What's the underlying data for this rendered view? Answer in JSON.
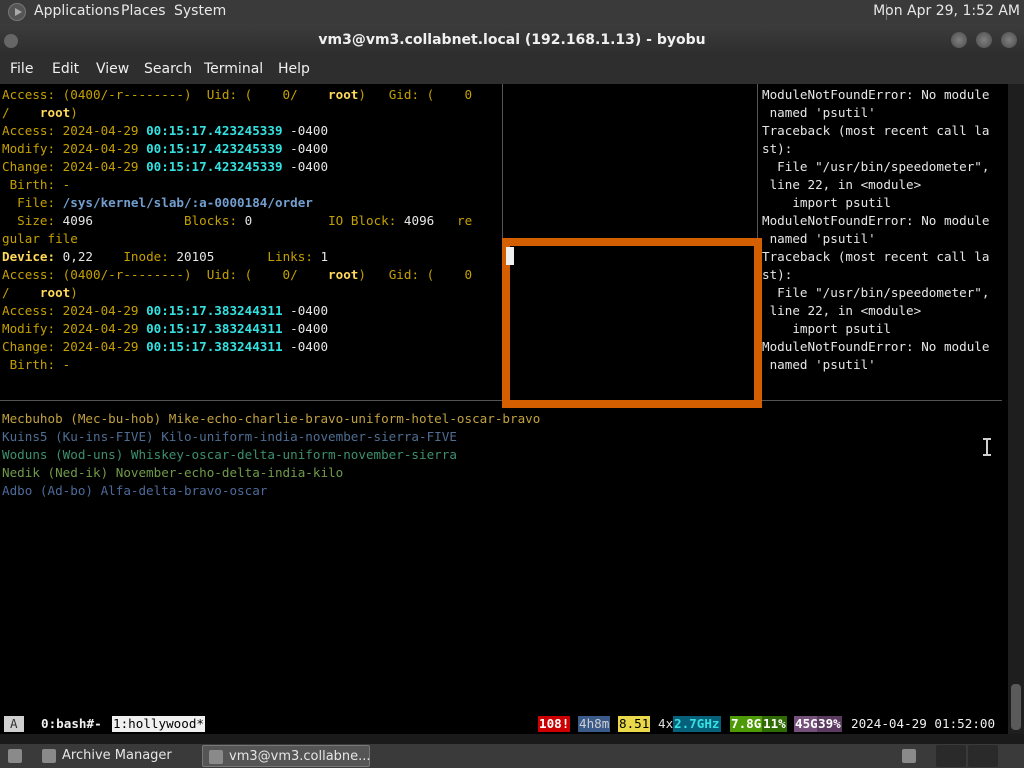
{
  "top_panel": {
    "menus": [
      "Applications",
      "Places",
      "System"
    ],
    "clock": "Mon Apr 29,  1:52 AM"
  },
  "window": {
    "title": "vm3@vm3.collabnet.local (192.168.1.13) - byobu",
    "menu": [
      "File",
      "Edit",
      "View",
      "Search",
      "Terminal",
      "Help"
    ]
  },
  "left_pane": {
    "lines": [
      [
        {
          "t": "Access: (0400/-r--------)  Uid: (    0/    ",
          "c": "c-y"
        },
        {
          "t": "root",
          "c": "c-ry"
        },
        {
          "t": ")   Gid: (    0",
          "c": "c-y"
        }
      ],
      [
        {
          "t": "/    ",
          "c": "c-y"
        },
        {
          "t": "root",
          "c": "c-ry"
        },
        {
          "t": ")",
          "c": "c-y"
        }
      ],
      [
        {
          "t": "Access: 2024-04-29 ",
          "c": "c-y"
        },
        {
          "t": "00:15:17.423245339",
          "c": "c-cy"
        },
        {
          "t": " -0400",
          "c": "c-w"
        }
      ],
      [
        {
          "t": "Modify: 2024-04-29 ",
          "c": "c-y"
        },
        {
          "t": "00:15:17.423245339",
          "c": "c-cy"
        },
        {
          "t": " -0400",
          "c": "c-w"
        }
      ],
      [
        {
          "t": "Change: 2024-04-29 ",
          "c": "c-y"
        },
        {
          "t": "00:15:17.423245339",
          "c": "c-cy"
        },
        {
          "t": " -0400",
          "c": "c-w"
        }
      ],
      [
        {
          "t": " Birth: -",
          "c": "c-y"
        }
      ],
      [
        {
          "t": "  File: ",
          "c": "c-y"
        },
        {
          "t": "/sys/kernel/slab/:a-0000184/order",
          "c": "c-bl"
        }
      ],
      [
        {
          "t": "  Size: ",
          "c": "c-y"
        },
        {
          "t": "4096",
          "c": "c-w"
        },
        {
          "t": "            Blocks: ",
          "c": "c-y"
        },
        {
          "t": "0",
          "c": "c-w"
        },
        {
          "t": "          IO Block: ",
          "c": "c-y"
        },
        {
          "t": "4096",
          "c": "c-w"
        },
        {
          "t": "   re",
          "c": "c-y"
        }
      ],
      [
        {
          "t": "gular file",
          "c": "c-y"
        }
      ],
      [
        {
          "t": "Device: ",
          "c": "c-ry"
        },
        {
          "t": "0,22",
          "c": "c-w"
        },
        {
          "t": "    Inode: ",
          "c": "c-y"
        },
        {
          "t": "20105",
          "c": "c-w"
        },
        {
          "t": "       Links: ",
          "c": "c-y"
        },
        {
          "t": "1",
          "c": "c-w"
        }
      ],
      [
        {
          "t": "Access: (0400/-r--------)  Uid: (    0/    ",
          "c": "c-y"
        },
        {
          "t": "root",
          "c": "c-ry"
        },
        {
          "t": ")   Gid: (    0",
          "c": "c-y"
        }
      ],
      [
        {
          "t": "/    ",
          "c": "c-y"
        },
        {
          "t": "root",
          "c": "c-ry"
        },
        {
          "t": ")",
          "c": "c-y"
        }
      ],
      [
        {
          "t": "Access: 2024-04-29 ",
          "c": "c-y"
        },
        {
          "t": "00:15:17.383244311",
          "c": "c-cy"
        },
        {
          "t": " -0400",
          "c": "c-w"
        }
      ],
      [
        {
          "t": "Modify: 2024-04-29 ",
          "c": "c-y"
        },
        {
          "t": "00:15:17.383244311",
          "c": "c-cy"
        },
        {
          "t": " -0400",
          "c": "c-w"
        }
      ],
      [
        {
          "t": "Change: 2024-04-29 ",
          "c": "c-y"
        },
        {
          "t": "00:15:17.383244311",
          "c": "c-cy"
        },
        {
          "t": " -0400",
          "c": "c-w"
        }
      ],
      [
        {
          "t": " Birth: -",
          "c": "c-y"
        }
      ]
    ]
  },
  "right_pane": {
    "lines": [
      "ModuleNotFoundError: No module",
      " named 'psutil'",
      "Traceback (most recent call la",
      "st):",
      "  File \"/usr/bin/speedometer\",",
      " line 22, in <module>",
      "    import psutil",
      "ModuleNotFoundError: No module",
      " named 'psutil'",
      "Traceback (most recent call la",
      "st):",
      "  File \"/usr/bin/speedometer\",",
      " line 22, in <module>",
      "    import psutil",
      "ModuleNotFoundError: No module",
      " named 'psutil'"
    ]
  },
  "bottom_pane": {
    "lines": [
      {
        "t": "Mecbuhob (Mec-bu-hob) Mike-echo-charlie-bravo-uniform-hotel-oscar-bravo",
        "c": "c-d1"
      },
      {
        "t": "Kuins5 (Ku-ins-FIVE) Kilo-uniform-india-november-sierra-FIVE",
        "c": "c-d2"
      },
      {
        "t": "Woduns (Wod-uns) Whiskey-oscar-delta-uniform-november-sierra",
        "c": "c-d3"
      },
      {
        "t": "Nedik (Ned-ik) November-echo-delta-india-kilo",
        "c": "c-d4"
      },
      {
        "t": "Adbo (Ad-bo) Alfa-delta-bravo-oscar",
        "c": "c-d5"
      }
    ]
  },
  "statusbar": {
    "logo": "A",
    "win0": "0:bash#-",
    "win1": "1:hollywood*",
    "updates": "108!",
    "uptime": "4h8m",
    "load": "8.51",
    "cpu_count": "4x",
    "cpu_freq": "2.7GHz",
    "mem_total": "7.8G",
    "mem_pct": "11%",
    "disk_total": "45G",
    "disk_pct": "39%",
    "datetime": "2024-04-29 01:52:00",
    "colors": {
      "updates_bg": "#cc0000",
      "uptime_bg": "#3a5a8a",
      "load_bg": "#e8d84a",
      "cpu_fg": "#34e2e2",
      "mem_bg": "#4e9a06",
      "disk_bg": "#75507b"
    }
  },
  "taskbar": {
    "items": [
      "Archive Manager",
      "vm3@vm3.collabne..."
    ]
  }
}
